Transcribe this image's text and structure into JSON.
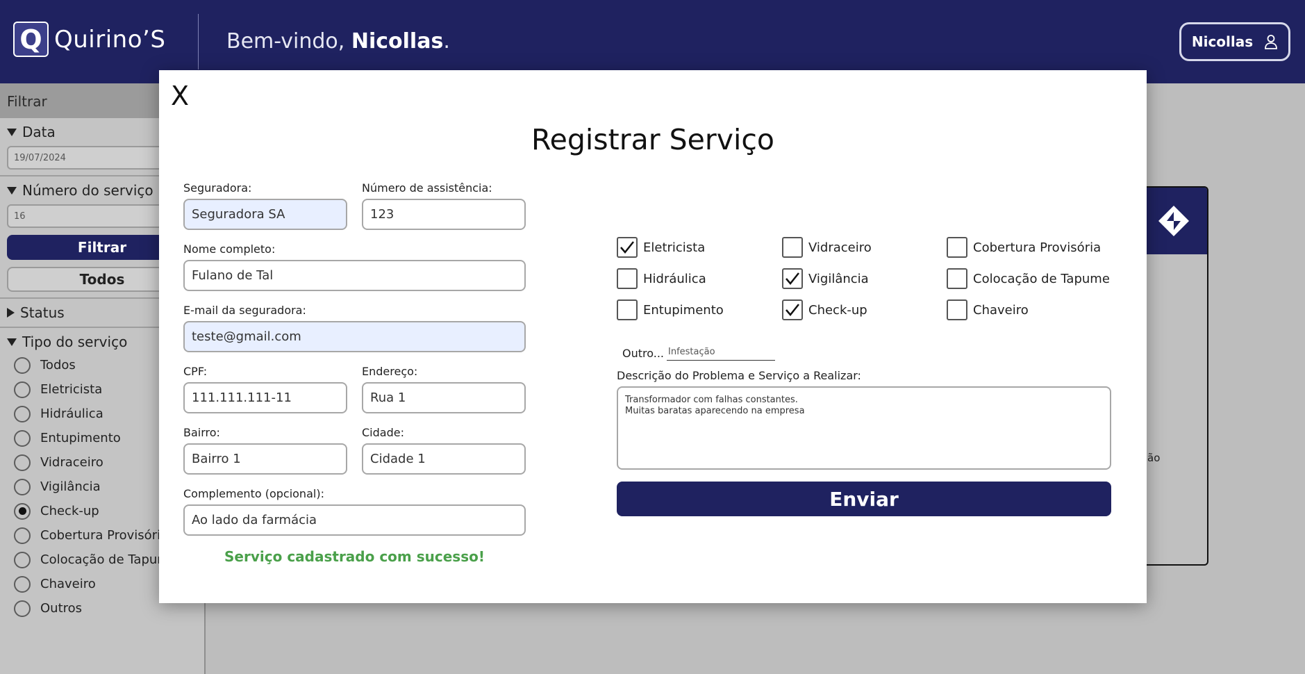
{
  "header": {
    "logo_letter": "Q",
    "brand": "Quirino’S",
    "welcome_prefix": "Bem-vindo, ",
    "welcome_name": "Nicollas",
    "welcome_suffix": ".",
    "user_label": "Nicollas",
    "user_icon": "user-icon"
  },
  "sidebar": {
    "heading": "Filtrar",
    "date_label": "Data",
    "date_value": "19/07/2024",
    "service_number_label": "Número do serviço",
    "service_number_value": "16",
    "filter_button": "Filtrar",
    "all_button": "Todos",
    "status_label": "Status",
    "service_type_label": "Tipo do serviço",
    "service_types": [
      {
        "label": "Todos",
        "checked": false
      },
      {
        "label": "Eletricista",
        "checked": false
      },
      {
        "label": "Hidráulica",
        "checked": false
      },
      {
        "label": "Entupimento",
        "checked": false
      },
      {
        "label": "Vidraceiro",
        "checked": false
      },
      {
        "label": "Vigilância",
        "checked": false
      },
      {
        "label": "Check-up",
        "checked": true
      },
      {
        "label": "Cobertura Provisória",
        "checked": false
      },
      {
        "label": "Colocação de Tapume",
        "checked": false
      },
      {
        "label": "Chaveiro",
        "checked": false
      },
      {
        "label": "Outros",
        "checked": false
      }
    ]
  },
  "background_card": {
    "partial_text": "ão"
  },
  "modal": {
    "close_label": "X",
    "title": "Registrar Serviço",
    "fields": {
      "insurer_label": "Seguradora:",
      "insurer_value": "Seguradora SA",
      "assist_number_label": "Número de assistência:",
      "assist_number_value": "123",
      "full_name_label": "Nome completo:",
      "full_name_value": "Fulano de Tal",
      "insurer_email_label": "E-mail da seguradora:",
      "insurer_email_value": "teste@gmail.com",
      "cpf_label": "CPF:",
      "cpf_value": "111.111.111-11",
      "address_label": "Endereço:",
      "address_value": "Rua 1",
      "neighborhood_label": "Bairro:",
      "neighborhood_value": "Bairro 1",
      "city_label": "Cidade:",
      "city_value": "Cidade 1",
      "complement_label": "Complemento (opcional):",
      "complement_value": "Ao lado da farmácia"
    },
    "success_message": "Serviço cadastrado com sucesso!",
    "services": [
      {
        "label": "Eletricista",
        "checked": true
      },
      {
        "label": "Vidraceiro",
        "checked": false
      },
      {
        "label": "Cobertura Provisória",
        "checked": false
      },
      {
        "label": "Hidráulica",
        "checked": false
      },
      {
        "label": "Vigilância",
        "checked": true
      },
      {
        "label": "Colocação de Tapume",
        "checked": false
      },
      {
        "label": "Entupimento",
        "checked": false
      },
      {
        "label": "Check-up",
        "checked": true
      },
      {
        "label": "Chaveiro",
        "checked": false
      }
    ],
    "other_label": "Outro...",
    "other_value": "Infestação",
    "description_label": "Descrição do Problema e Serviço a Realizar:",
    "description_value": "Transformador com falhas constantes.\nMuitas baratas aparecendo na empresa",
    "send_button": "Enviar"
  },
  "colors": {
    "brand_navy": "#1f2260",
    "success_green": "#4aa04a",
    "autofill_blue": "#e8efff"
  }
}
